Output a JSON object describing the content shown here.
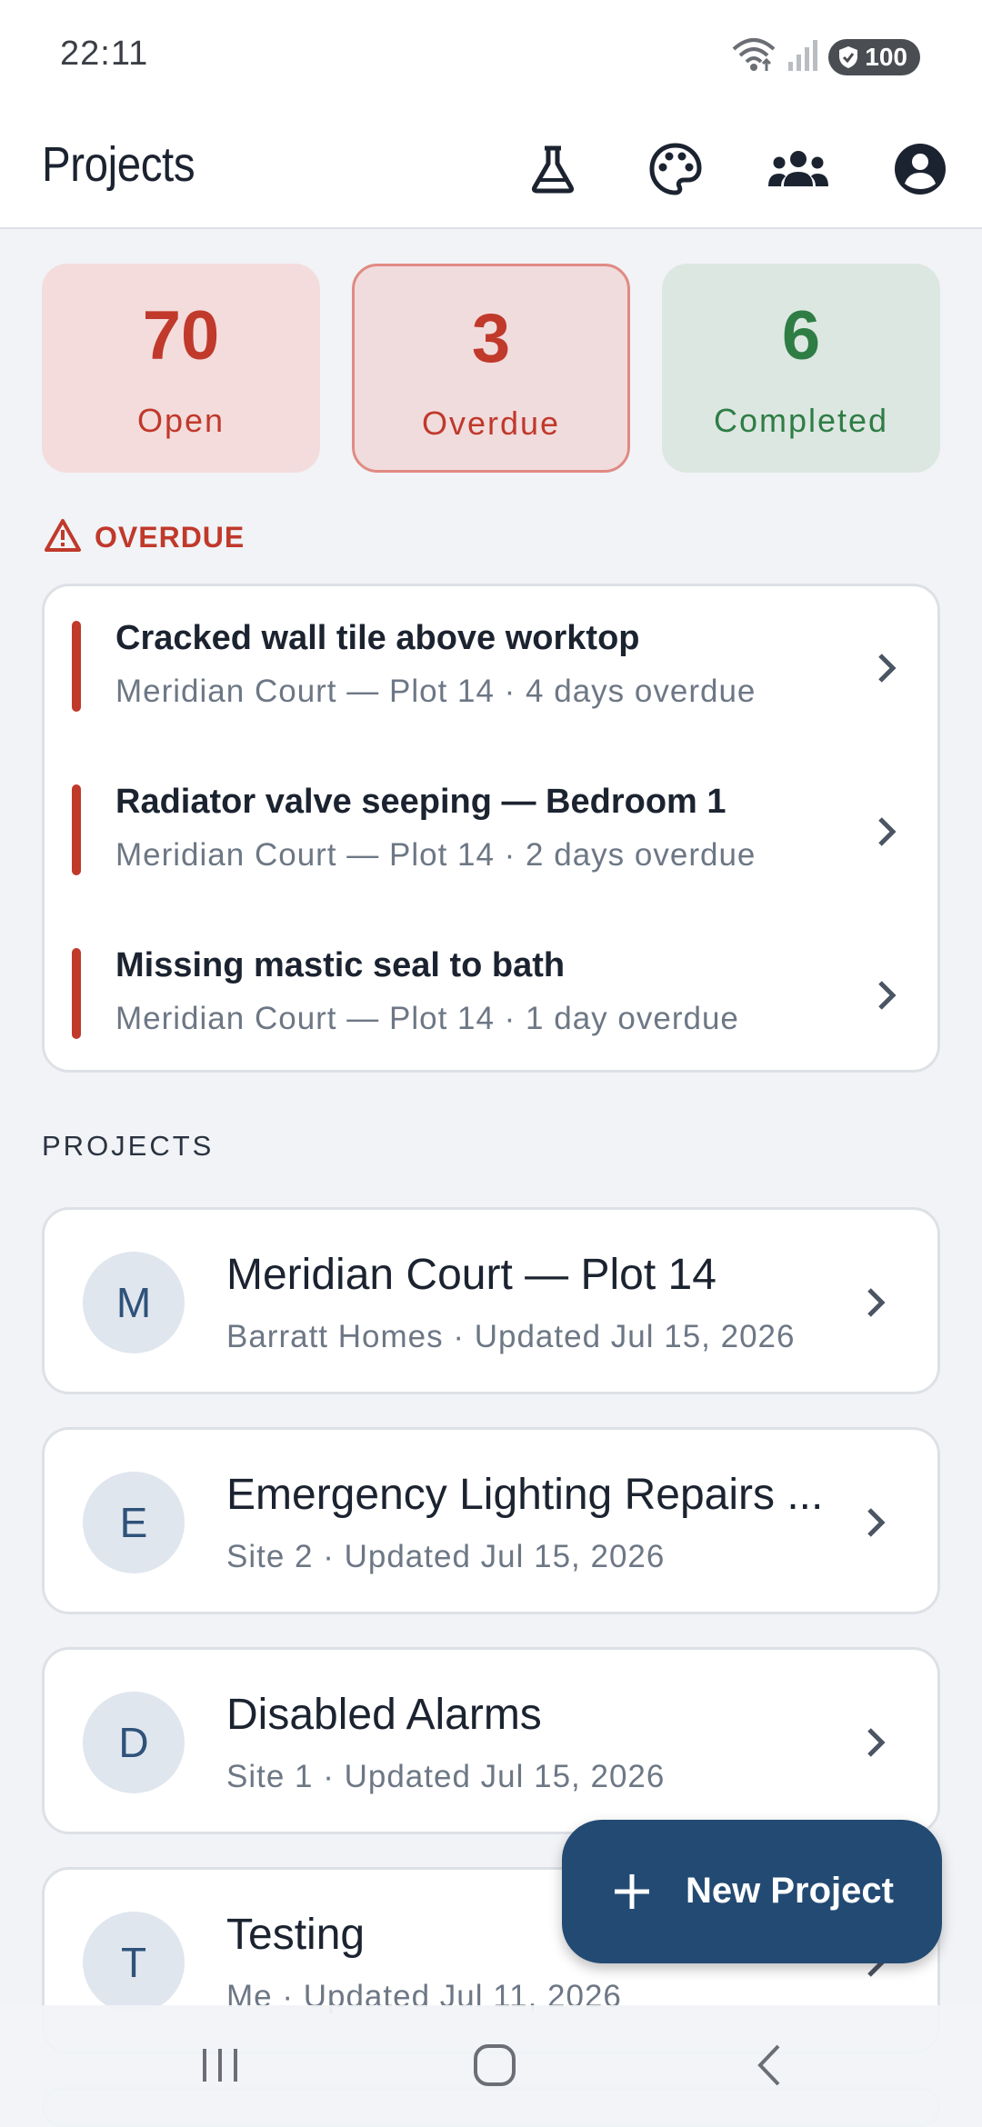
{
  "status_bar": {
    "time": "22:11",
    "battery": "100"
  },
  "app_bar": {
    "title": "Projects",
    "actions": [
      "flask-icon",
      "palette-icon",
      "group-icon",
      "account-icon"
    ]
  },
  "stats": {
    "open": {
      "value": "70",
      "label": "Open"
    },
    "overdue": {
      "value": "3",
      "label": "Overdue"
    },
    "completed": {
      "value": "6",
      "label": "Completed"
    }
  },
  "overdue_section": {
    "heading": "OVERDUE",
    "items": [
      {
        "title": "Cracked wall tile above worktop",
        "subtitle": "Meridian Court — Plot 14 · 4 days overdue"
      },
      {
        "title": "Radiator valve seeping — Bedroom 1",
        "subtitle": "Meridian Court — Plot 14 · 2 days overdue"
      },
      {
        "title": "Missing mastic seal to bath",
        "subtitle": "Meridian Court — Plot 14 · 1 day overdue"
      }
    ]
  },
  "projects_section": {
    "heading": "PROJECTS",
    "items": [
      {
        "initial": "M",
        "name": "Meridian Court — Plot 14",
        "meta": "Barratt Homes · Updated Jul 15, 2026"
      },
      {
        "initial": "E",
        "name": "Emergency Lighting Repairs ...",
        "meta": "Site 2 · Updated Jul 15, 2026"
      },
      {
        "initial": "D",
        "name": "Disabled Alarms",
        "meta": "Site 1 · Updated Jul 15, 2026"
      },
      {
        "initial": "T",
        "name": "Testing",
        "meta": "Me · Updated Jul 11, 2026"
      }
    ]
  },
  "fab": {
    "label": "New Project"
  },
  "colors": {
    "accent": "#234a73",
    "danger": "#c0392b",
    "success": "#2e7d45"
  }
}
